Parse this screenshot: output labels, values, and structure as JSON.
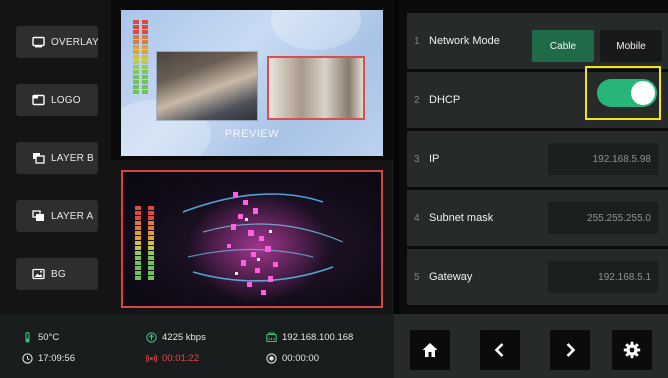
{
  "layers": [
    {
      "label": "OVERLAY",
      "icon": "overlay-icon"
    },
    {
      "label": "LOGO",
      "icon": "logo-icon"
    },
    {
      "label": "LAYER B",
      "icon": "layer-b-icon"
    },
    {
      "label": "LAYER A",
      "icon": "layer-a-icon"
    },
    {
      "label": "BG",
      "icon": "image-icon"
    }
  ],
  "preview": {
    "label": "PREVIEW"
  },
  "status": {
    "temperature": "50°C",
    "clock": "17:09:56",
    "bitrate": "4225 kbps",
    "stream_time": "00:01:22",
    "ip": "192.168.100.168",
    "record_time": "00:00:00"
  },
  "settings": [
    {
      "index": "1",
      "label": "Network Mode",
      "options": [
        "Cable",
        "Mobile"
      ],
      "selected": "Cable"
    },
    {
      "index": "2",
      "label": "DHCP",
      "enabled": true
    },
    {
      "index": "3",
      "label": "IP",
      "value": "192.168.5.98"
    },
    {
      "index": "4",
      "label": "Subnet mask",
      "value": "255.255.255.0"
    },
    {
      "index": "5",
      "label": "Gateway",
      "value": "192.168.5.1"
    }
  ],
  "nav": [
    {
      "icon": "home-icon"
    },
    {
      "icon": "chevron-left-icon"
    },
    {
      "icon": "chevron-right-icon"
    },
    {
      "icon": "gear-icon"
    }
  ],
  "colors": {
    "accent_green": "#28b57a",
    "selected_segment": "#1f6b47",
    "highlight_box": "#f4e21c",
    "program_border": "#d64545"
  }
}
